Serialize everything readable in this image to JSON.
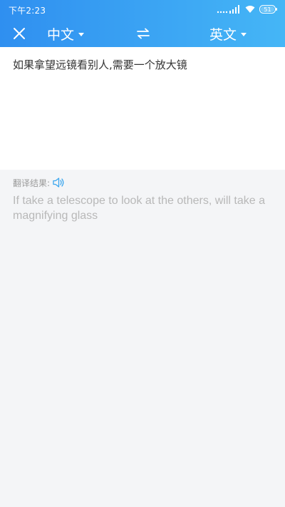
{
  "status_bar": {
    "time": "下午2:23",
    "battery": "51"
  },
  "toolbar": {
    "source_language": "中文",
    "target_language": "英文"
  },
  "source": {
    "text": "如果拿望远镜看别人,需要一个放大镜"
  },
  "result": {
    "label": "翻译结果:",
    "text": "If take a telescope to look at the others, will take a magnifying glass"
  },
  "colors": {
    "header_start": "#2f8ff0",
    "header_end": "#45b6f6",
    "speaker_icon": "#3ba6ee",
    "result_text": "#b8b8b8"
  },
  "icons": {
    "close": "close-icon",
    "caret": "caret-down-icon",
    "swap": "swap-icon",
    "speaker": "speaker-icon"
  }
}
